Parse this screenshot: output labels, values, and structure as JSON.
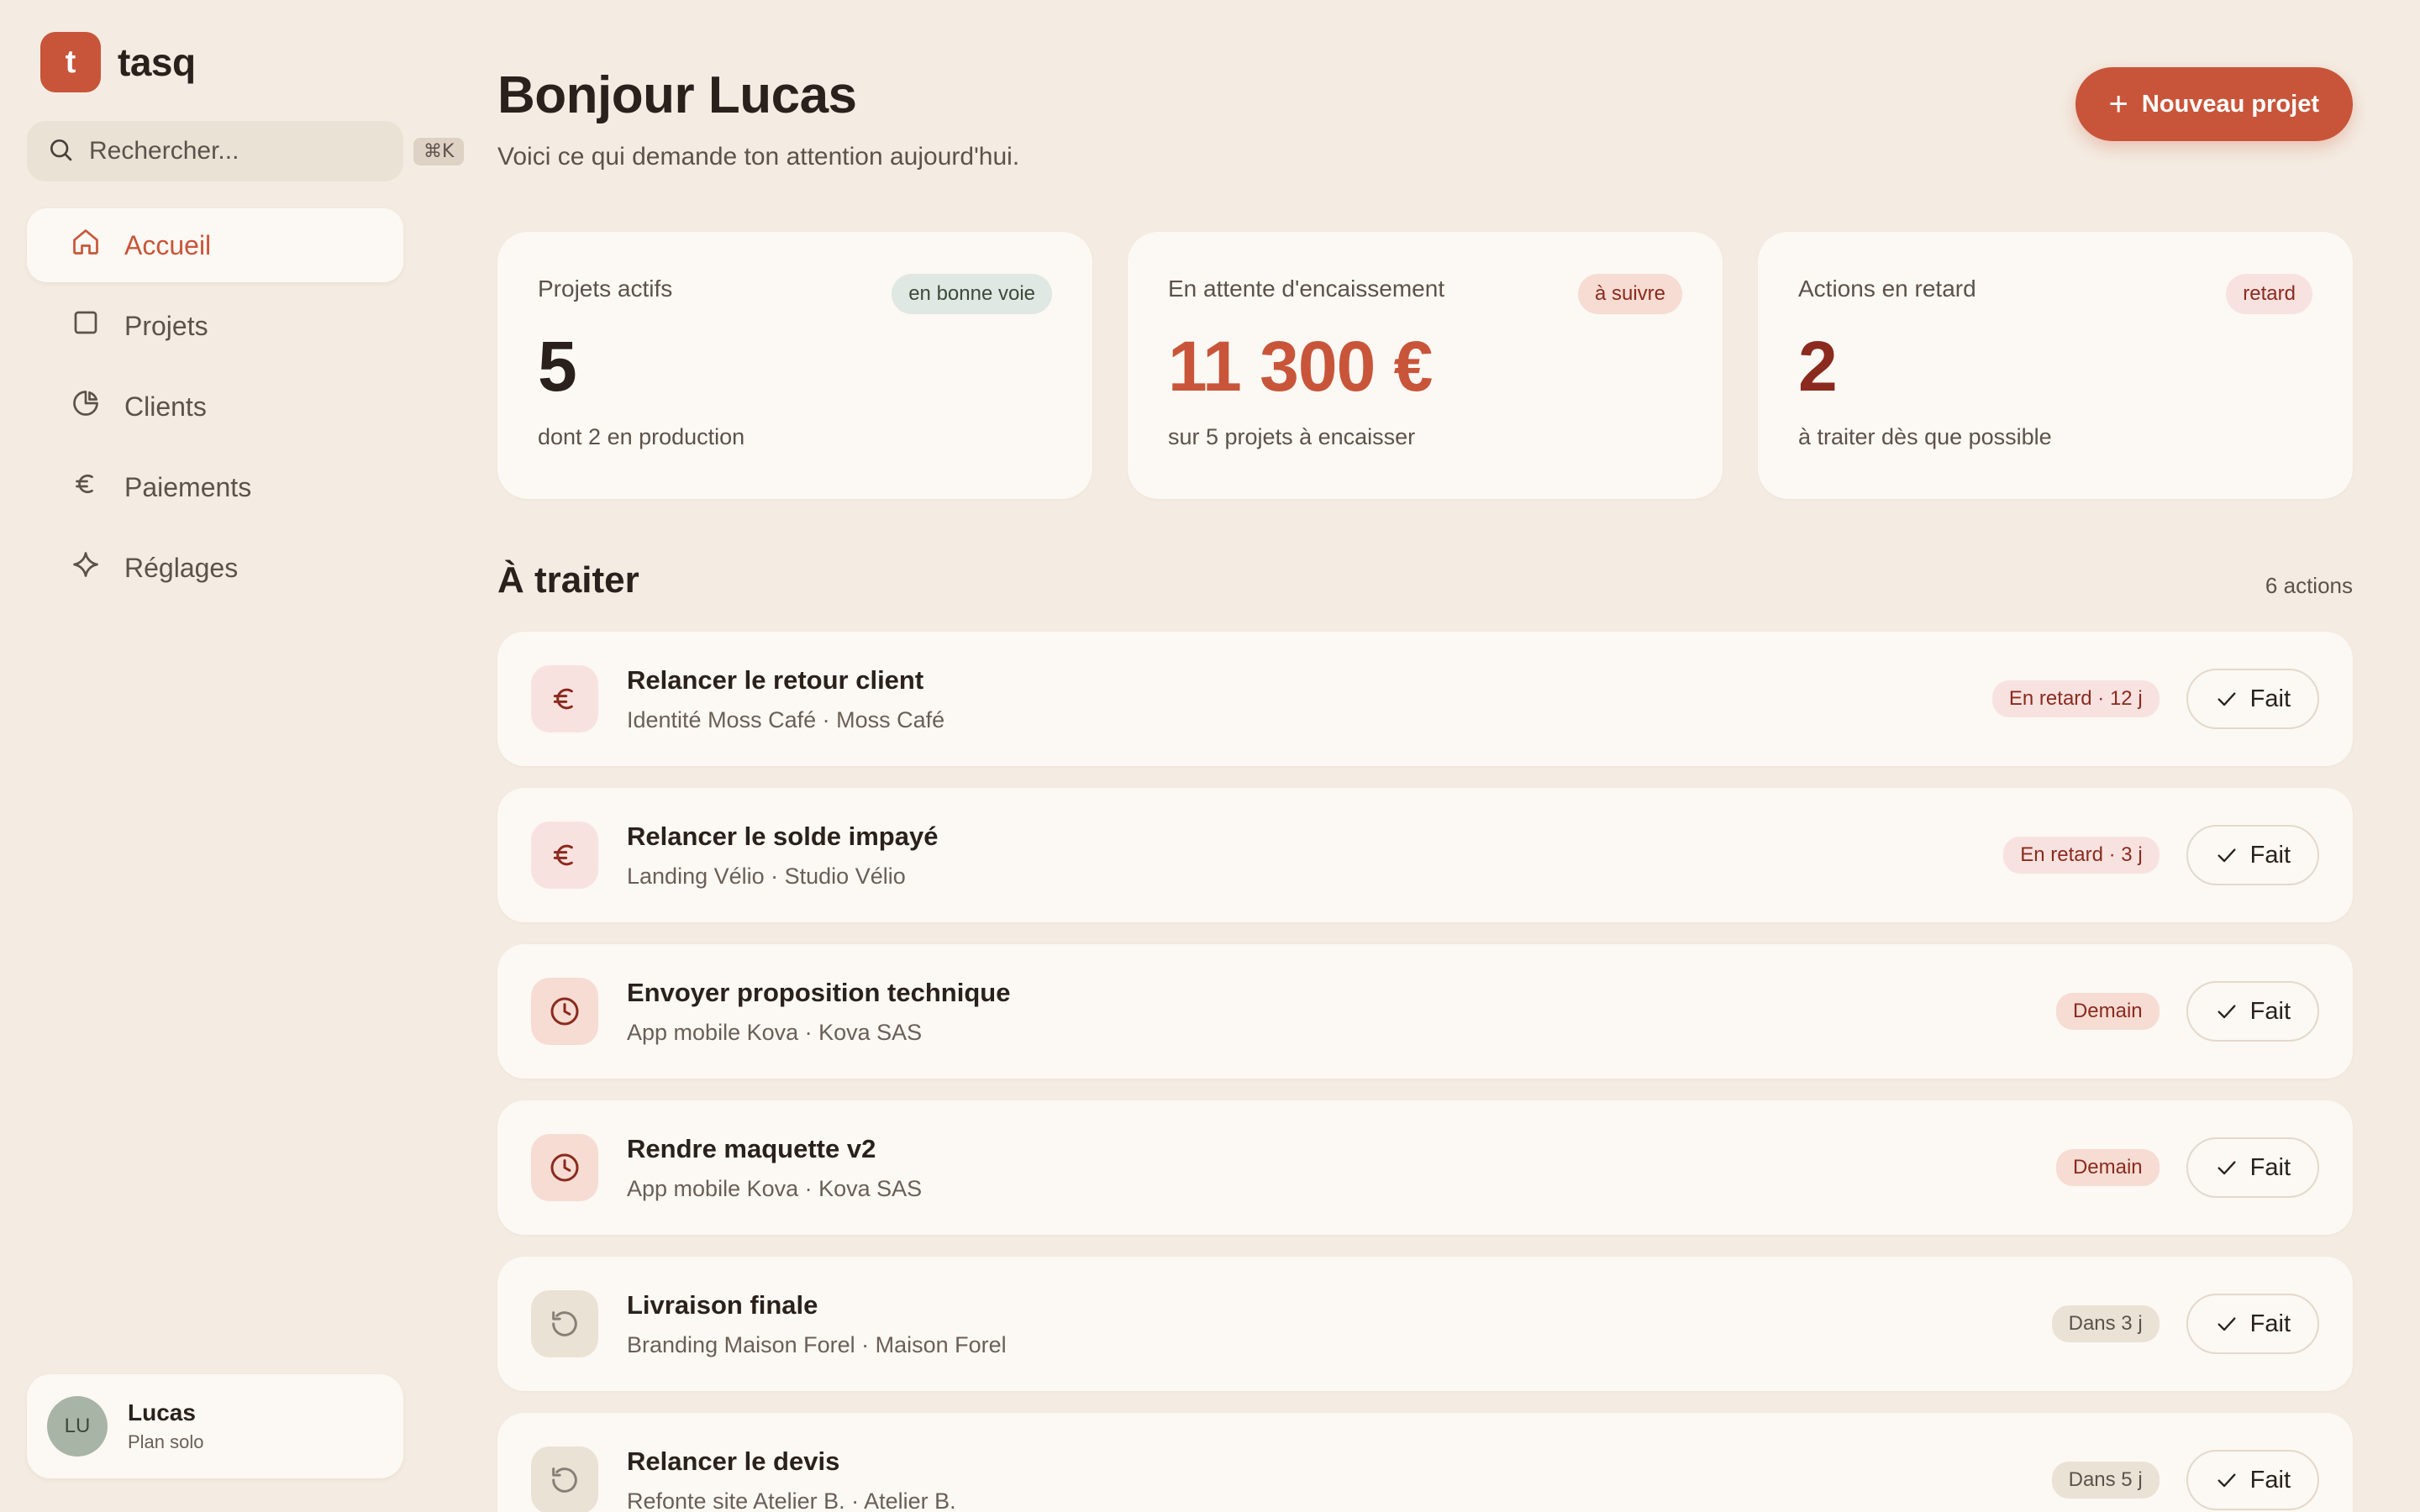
{
  "brand": {
    "logo_letter": "t",
    "name": "tasq"
  },
  "search": {
    "placeholder": "Rechercher...",
    "shortcut": "⌘K"
  },
  "nav": [
    {
      "label": "Accueil",
      "icon": "home-icon",
      "active": true
    },
    {
      "label": "Projets",
      "icon": "square-icon"
    },
    {
      "label": "Clients",
      "icon": "pie-chart-icon"
    },
    {
      "label": "Paiements",
      "icon": "euro-icon"
    },
    {
      "label": "Réglages",
      "icon": "sparkle-icon"
    }
  ],
  "user": {
    "initials": "LU",
    "name": "Lucas",
    "plan": "Plan solo"
  },
  "header": {
    "greeting": "Bonjour Lucas",
    "subtitle": "Voici ce qui demande ton attention aujourd'hui.",
    "new_project_label": "Nouveau projet"
  },
  "stats": [
    {
      "label": "Projets actifs",
      "badge": "en bonne voie",
      "value": "5",
      "note": "dont 2 en production"
    },
    {
      "label": "En attente d'encaissement",
      "badge": "à suivre",
      "value": "11 300 €",
      "note": "sur 5 projets à encaisser"
    },
    {
      "label": "Actions en retard",
      "badge": "retard",
      "value": "2",
      "note": "à traiter dès que possible"
    }
  ],
  "section": {
    "title": "À traiter",
    "count": "6 actions"
  },
  "tasks": [
    {
      "title": "Relancer le retour client",
      "meta": "Identité Moss Café · Moss Café",
      "badge": "En retard · 12 j",
      "icon": "euro-icon",
      "done_label": "Fait"
    },
    {
      "title": "Relancer le solde impayé",
      "meta": "Landing Vélio · Studio Vélio",
      "badge": "En retard · 3 j",
      "icon": "euro-icon",
      "done_label": "Fait"
    },
    {
      "title": "Envoyer proposition technique",
      "meta": "App mobile Kova · Kova SAS",
      "badge": "Demain",
      "icon": "clock-icon",
      "done_label": "Fait"
    },
    {
      "title": "Rendre maquette v2",
      "meta": "App mobile Kova · Kova SAS",
      "badge": "Demain",
      "icon": "clock-icon",
      "done_label": "Fait"
    },
    {
      "title": "Livraison finale",
      "meta": "Branding Maison Forel · Maison Forel",
      "badge": "Dans 3 j",
      "icon": "reload-icon",
      "done_label": "Fait"
    },
    {
      "title": "Relancer le devis",
      "meta": "Refonte site Atelier B. · Atelier B.",
      "badge": "Dans 5 j",
      "icon": "reload-icon",
      "done_label": "Fait"
    }
  ],
  "colors": {
    "accent": "#c8553a",
    "background": "#f4ece2",
    "card": "#fcf8f3",
    "danger": "#8b2a1e"
  }
}
